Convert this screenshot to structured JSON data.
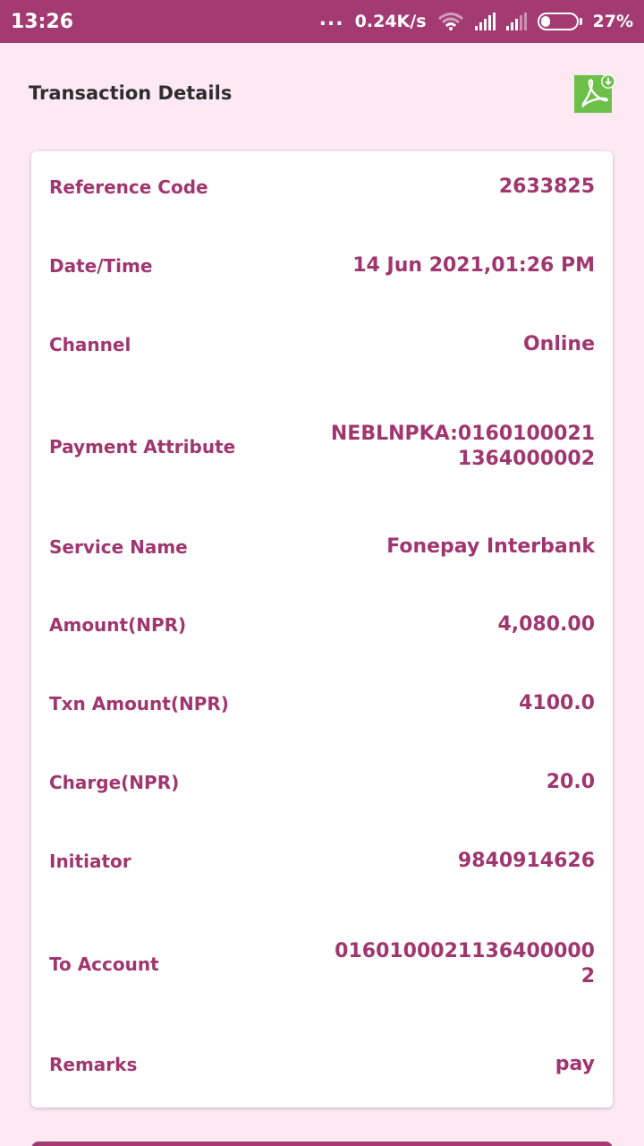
{
  "status_bar": {
    "time": "13:26",
    "dots": "...",
    "network_speed": "0.24K/s",
    "battery_percent": "27%",
    "battery_level": 0.27,
    "icons": [
      "wifi-icon",
      "signal-icon",
      "signal-icon",
      "battery-icon"
    ]
  },
  "header": {
    "title": "Transaction Details",
    "pdf_icon": "pdf-download-icon",
    "pdf_icon_color": "#6cc04a"
  },
  "colors": {
    "accent": "#a33a72",
    "text": "#a0366f",
    "background": "#fde9f1",
    "card": "#ffffff"
  },
  "details": [
    {
      "label": "Reference Code",
      "value": "2633825"
    },
    {
      "label": "Date/Time",
      "value": "14 Jun 2021,01:26 PM"
    },
    {
      "label": "Channel",
      "value": "Online"
    },
    {
      "label": "Payment Attribute",
      "value": "NEBLNPKA:01601000211364000002"
    },
    {
      "label": "Service Name",
      "value": "Fonepay Interbank"
    },
    {
      "label": "Amount(NPR)",
      "value": "4,080.00"
    },
    {
      "label": "Txn Amount(NPR)",
      "value": "4100.0"
    },
    {
      "label": "Charge(NPR)",
      "value": "20.0"
    },
    {
      "label": "Initiator",
      "value": "9840914626"
    },
    {
      "label": "To Account",
      "value": "01601000211364000002"
    },
    {
      "label": "Remarks",
      "value": "pay"
    }
  ]
}
